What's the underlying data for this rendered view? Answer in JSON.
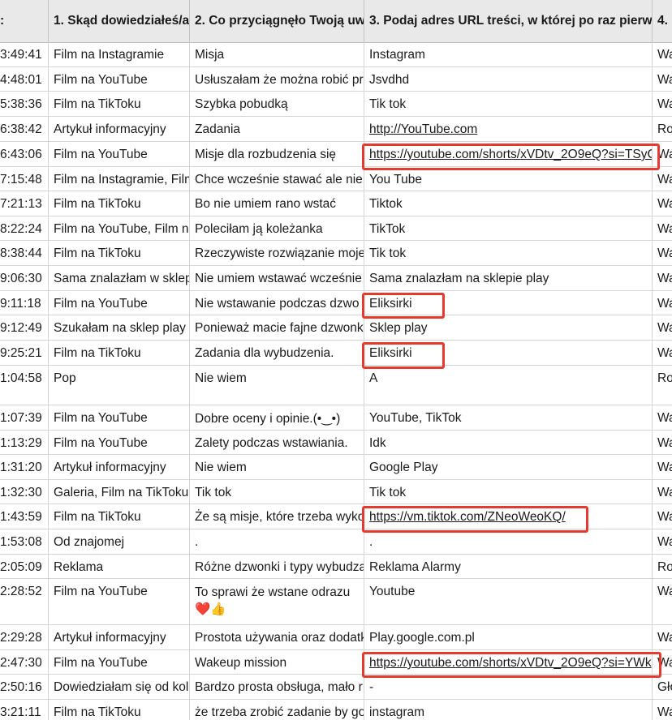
{
  "header": {
    "col0": ":",
    "col1": "1. Skąd dowiedziałeś/a",
    "col2": "2. Co przyciągnęło Twoją uw",
    "col3": "3. Podaj adres URL treści, w której po raz pierw",
    "col4": "4."
  },
  "rows": [
    {
      "time": "3:49:41",
      "source": "Film na Instagramie",
      "reason": "Misja",
      "url": "Instagram",
      "col4": "Wa"
    },
    {
      "time": "4:48:01",
      "source": "Film na YouTube",
      "reason": "Usłuszałam że można robić pr",
      "url": "Jsvdhd",
      "col4": "Wa"
    },
    {
      "time": "5:38:36",
      "source": "Film na TikToku",
      "reason": "Szybka pobudką",
      "url": "Tik tok",
      "col4": "Wa"
    },
    {
      "time": "6:38:42",
      "source": "Artykuł informacyjny",
      "reason": "Zadania",
      "url": "http://YouTube.com",
      "col4": "Ro"
    },
    {
      "time": "6:43:06",
      "source": "Film na YouTube",
      "reason": "Misje dla rozbudzenia się",
      "url": "https://youtube.com/shorts/xVDtv_2O9eQ?si=TSyC",
      "col4": "Wa"
    },
    {
      "time": "7:15:48",
      "source": "Film na Instagramie, Film",
      "reason": "Chce wcześnie stawać ale nie",
      "url": "You Tube",
      "col4": "Wa"
    },
    {
      "time": "7:21:13",
      "source": "Film na TikToku",
      "reason": "Bo nie umiem rano wstać",
      "url": "Tiktok",
      "col4": "Wa"
    },
    {
      "time": "8:22:24",
      "source": "Film na YouTube, Film na",
      "reason": "Poleciłam ją koleżanka",
      "url": "TikTok",
      "col4": "Wa"
    },
    {
      "time": "8:38:44",
      "source": "Film na TikToku",
      "reason": "Rzeczywiste rozwiązanie moje",
      "url": "Tik tok",
      "col4": "Wa"
    },
    {
      "time": "9:06:30",
      "source": "Sama znalazłam w sklep",
      "reason": "Nie umiem wstawać wcześnie",
      "url": "Sama znalazłam na sklepie play",
      "col4": "Wa"
    },
    {
      "time": "9:11:18",
      "source": "Film na YouTube",
      "reason": "Nie wstawanie podczas dzwo",
      "url": "Eliksirki",
      "col4": "Wa"
    },
    {
      "time": "9:12:49",
      "source": "Szukałam na sklep play",
      "reason": "Ponieważ macie fajne dzwonki",
      "url": "Sklep play",
      "col4": "Wa"
    },
    {
      "time": "9:25:21",
      "source": "Film na TikToku",
      "reason": "Zadania dla wybudzenia.",
      "url": "Eliksirki",
      "col4": "Wa"
    },
    {
      "time": "1:04:58",
      "source": "Pop",
      "reason": "Nie wiem",
      "url": "A",
      "col4": "Ro"
    },
    {
      "time": "1:07:39",
      "source": "Film na YouTube",
      "reason": "Dobre oceny i opinie.(•‿•)",
      "url": "YouTube, TikTok",
      "col4": "Wa"
    },
    {
      "time": "1:13:29",
      "source": "Film na YouTube",
      "reason": "Zalety podczas wstawiania.",
      "url": "Idk",
      "col4": "Wa"
    },
    {
      "time": "1:31:20",
      "source": "Artykuł informacyjny",
      "reason": "Nie wiem",
      "url": "Google Play",
      "col4": "Wa"
    },
    {
      "time": "1:32:30",
      "source": "Galeria, Film na TikToku",
      "reason": "Tik tok",
      "url": "Tik tok",
      "col4": "Wa"
    },
    {
      "time": "1:43:59",
      "source": "Film na TikToku",
      "reason": "Że są misje, które trzeba wyko",
      "url": "https://vm.tiktok.com/ZNeoWeoKQ/",
      "col4": "Wa"
    },
    {
      "time": "1:53:08",
      "source": "Od znajomej",
      "reason": ".",
      "url": ".",
      "col4": "Wa"
    },
    {
      "time": "2:05:09",
      "source": "Reklama",
      "reason": "Różne dzwonki i typy wybudza",
      "url": "Reklama Alarmy",
      "col4": "Ro"
    },
    {
      "time": "2:28:52",
      "source": "Film na YouTube",
      "reason": "To sprawi że wstane odrazu ❤️👍",
      "url": "Youtube",
      "col4": "Wa"
    },
    {
      "time": "2:29:28",
      "source": "Artykuł informacyjny",
      "reason": "Prostota używania oraz dodatk",
      "url": "Play.google.com.pl",
      "col4": "Wa"
    },
    {
      "time": "2:47:30",
      "source": "Film na YouTube",
      "reason": "Wakeup mission",
      "url": "https://youtube.com/shorts/xVDtv_2O9eQ?si=YWk",
      "col4": "Wa"
    },
    {
      "time": "2:50:16",
      "source": "Dowiedziałam się od kol",
      "reason": "Bardzo prosta obsługa, mało r",
      "url": "-",
      "col4": "Gło"
    },
    {
      "time": "3:21:11",
      "source": "Film na TikToku",
      "reason": "że trzeba zrobić zadanie by go",
      "url": "instagram",
      "col4": "Wa"
    }
  ],
  "highlight_color": "#e53a2f"
}
